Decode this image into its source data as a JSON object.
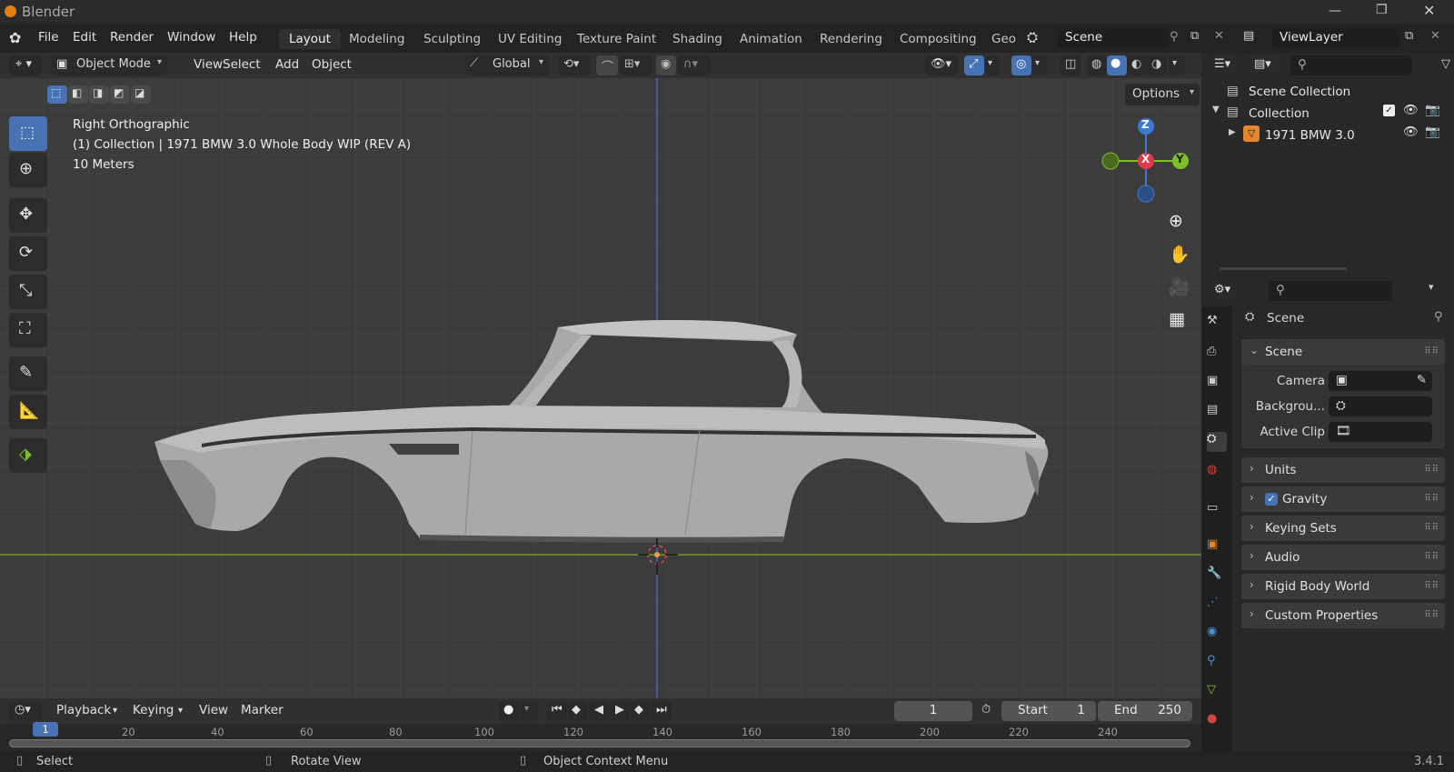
{
  "app": {
    "title": "Blender",
    "version": "3.4.1"
  },
  "menus": [
    "File",
    "Edit",
    "Render",
    "Window",
    "Help"
  ],
  "workspaces": [
    "Layout",
    "Modeling",
    "Sculpting",
    "UV Editing",
    "Texture Paint",
    "Shading",
    "Animation",
    "Rendering",
    "Compositing",
    "Geo"
  ],
  "active_workspace": "Layout",
  "scene_field": "Scene",
  "viewlayer_field": "ViewLayer",
  "viewport_header": {
    "mode": "Object Mode",
    "menus": [
      "View",
      "Select",
      "Add",
      "Object"
    ],
    "transform_orientation": "Global",
    "options_label": "Options"
  },
  "viewport": {
    "view_name": "Right Orthographic",
    "collection_info": "(1) Collection | 1971 BMW 3.0 Whole Body WIP (REV A)",
    "scale_text": "10 Meters",
    "gizmo": {
      "z": "Z",
      "x": "X",
      "y": "Y"
    }
  },
  "outliner": {
    "root": "Scene Collection",
    "collection": "Collection",
    "object": "1971 BMW 3.0"
  },
  "properties": {
    "header": "Scene",
    "section": "Scene",
    "fields": [
      {
        "label": "Camera"
      },
      {
        "label": "Backgrou..."
      },
      {
        "label": "Active Clip"
      }
    ],
    "panels": [
      "Units",
      "Gravity",
      "Keying Sets",
      "Audio",
      "Rigid Body World",
      "Custom Properties"
    ],
    "gravity_checked": true
  },
  "timeline": {
    "menus": [
      "Playback",
      "Keying",
      "View",
      "Marker"
    ],
    "current_frame": "1",
    "start_label": "Start",
    "start_value": "1",
    "end_label": "End",
    "end_value": "250",
    "ticks": [
      "1",
      "20",
      "40",
      "60",
      "80",
      "100",
      "120",
      "140",
      "160",
      "180",
      "200",
      "220",
      "240"
    ]
  },
  "statusbar": {
    "select": "Select",
    "rotate": "Rotate View",
    "context": "Object Context Menu"
  },
  "colors": {
    "accent": "#4772b3",
    "axis_x": "#e5394b",
    "axis_y": "#7fbf2a",
    "axis_z": "#3a7ad6"
  }
}
